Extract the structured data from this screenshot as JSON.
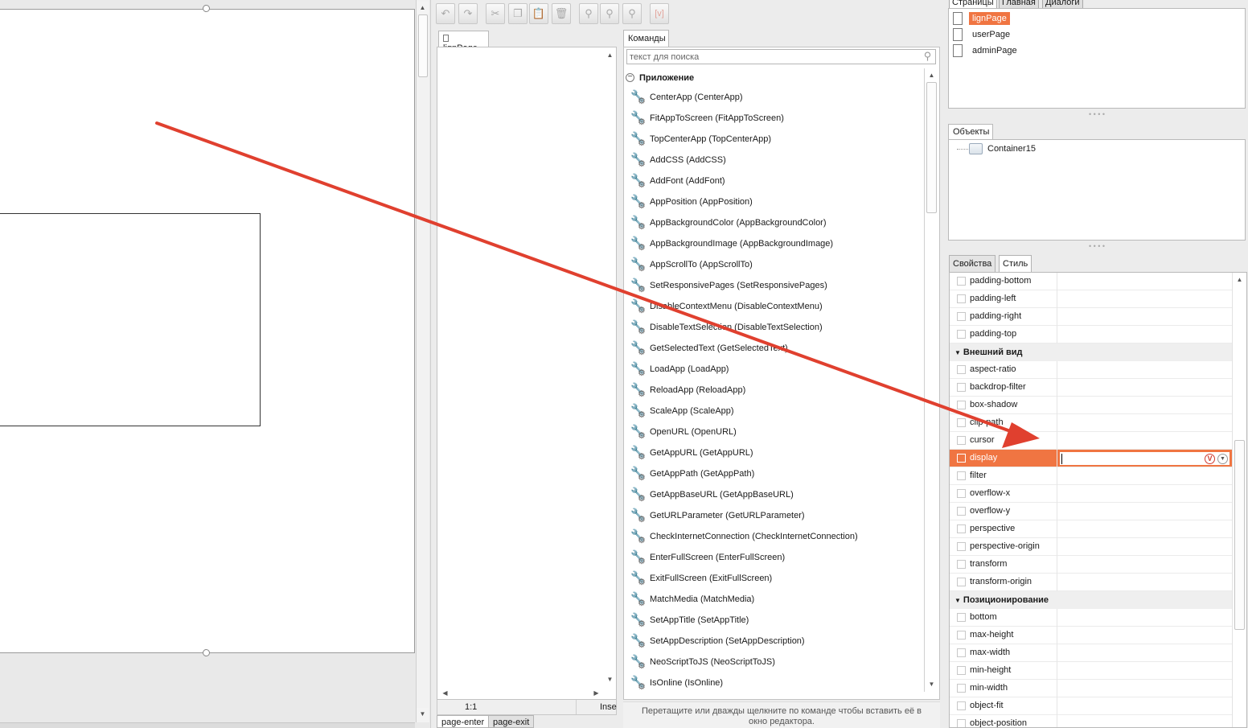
{
  "toolbar": {
    "buttons": [
      {
        "name": "undo-icon",
        "glyph": "↶"
      },
      {
        "name": "redo-icon",
        "glyph": "↷"
      },
      {
        "name": "cut-icon",
        "glyph": "✂"
      },
      {
        "name": "copy-icon",
        "glyph": "❐"
      },
      {
        "name": "paste-icon",
        "glyph": "📋"
      },
      {
        "name": "delete-icon",
        "glyph": "🗑"
      },
      {
        "name": "find-icon",
        "glyph": "⚲"
      },
      {
        "name": "find-next-icon",
        "glyph": "⚲"
      },
      {
        "name": "replace-icon",
        "glyph": "⚲"
      },
      {
        "name": "variable-icon",
        "glyph": "[v]"
      }
    ]
  },
  "editor": {
    "tab_label": "lignPage",
    "status_zoom": "1:1",
    "status_mode": "Inse",
    "bottom_tabs": [
      "page-enter",
      "page-exit"
    ]
  },
  "commands": {
    "tab_label": "Команды",
    "search_placeholder": "текст для поиска",
    "group_label": "Приложение",
    "items": [
      "CenterApp (CenterApp)",
      "FitAppToScreen (FitAppToScreen)",
      "TopCenterApp (TopCenterApp)",
      "AddCSS (AddCSS)",
      "AddFont (AddFont)",
      "AppPosition (AppPosition)",
      "AppBackgroundColor (AppBackgroundColor)",
      "AppBackgroundImage (AppBackgroundImage)",
      "AppScrollTo (AppScrollTo)",
      "SetResponsivePages (SetResponsivePages)",
      "DisableContextMenu (DisableContextMenu)",
      "DisableTextSelection (DisableTextSelection)",
      "GetSelectedText (GetSelectedText)",
      "LoadApp (LoadApp)",
      "ReloadApp (ReloadApp)",
      "ScaleApp (ScaleApp)",
      "OpenURL (OpenURL)",
      "GetAppURL (GetAppURL)",
      "GetAppPath (GetAppPath)",
      "GetAppBaseURL (GetAppBaseURL)",
      "GetURLParameter (GetURLParameter)",
      "CheckInternetConnection (CheckInternetConnection)",
      "EnterFullScreen (EnterFullScreen)",
      "ExitFullScreen (ExitFullScreen)",
      "MatchMedia (MatchMedia)",
      "SetAppTitle (SetAppTitle)",
      "SetAppDescription (SetAppDescription)",
      "NeoScriptToJS (NeoScriptToJS)",
      "IsOnline (IsOnline)"
    ],
    "hint_line1": "Перетащите или дважды щелкните по команде чтобы вставить её в",
    "hint_line2": "окно редактора."
  },
  "pages_panel": {
    "tabs": [
      "Страницы",
      "Главная",
      "Диалоги"
    ],
    "pages": [
      "lignPage",
      "userPage",
      "adminPage"
    ],
    "selected_index": 0
  },
  "objects_panel": {
    "tab_label": "Объекты",
    "items": [
      "Container15"
    ]
  },
  "props_panel": {
    "tabs": [
      "Свойства",
      "Стиль"
    ],
    "active_tab": "Стиль",
    "rows": [
      {
        "kind": "prop",
        "name": "padding-bottom"
      },
      {
        "kind": "prop",
        "name": "padding-left"
      },
      {
        "kind": "prop",
        "name": "padding-right"
      },
      {
        "kind": "prop",
        "name": "padding-top"
      },
      {
        "kind": "group",
        "name": "Внешний вид"
      },
      {
        "kind": "prop",
        "name": "aspect-ratio"
      },
      {
        "kind": "prop",
        "name": "backdrop-filter"
      },
      {
        "kind": "prop",
        "name": "box-shadow"
      },
      {
        "kind": "prop",
        "name": "clip-path"
      },
      {
        "kind": "prop",
        "name": "cursor"
      },
      {
        "kind": "prop",
        "name": "display",
        "selected": true,
        "value": ""
      },
      {
        "kind": "prop",
        "name": "filter"
      },
      {
        "kind": "prop",
        "name": "overflow-x"
      },
      {
        "kind": "prop",
        "name": "overflow-y"
      },
      {
        "kind": "prop",
        "name": "perspective"
      },
      {
        "kind": "prop",
        "name": "perspective-origin"
      },
      {
        "kind": "prop",
        "name": "transform"
      },
      {
        "kind": "prop",
        "name": "transform-origin"
      },
      {
        "kind": "group",
        "name": "Позиционирование"
      },
      {
        "kind": "prop",
        "name": "bottom"
      },
      {
        "kind": "prop",
        "name": "max-height"
      },
      {
        "kind": "prop",
        "name": "max-width"
      },
      {
        "kind": "prop",
        "name": "min-height"
      },
      {
        "kind": "prop",
        "name": "min-width"
      },
      {
        "kind": "prop",
        "name": "object-fit"
      },
      {
        "kind": "prop",
        "name": "object-position"
      }
    ]
  },
  "colors": {
    "accent": "#f07542",
    "arrow": "#e0402f"
  }
}
